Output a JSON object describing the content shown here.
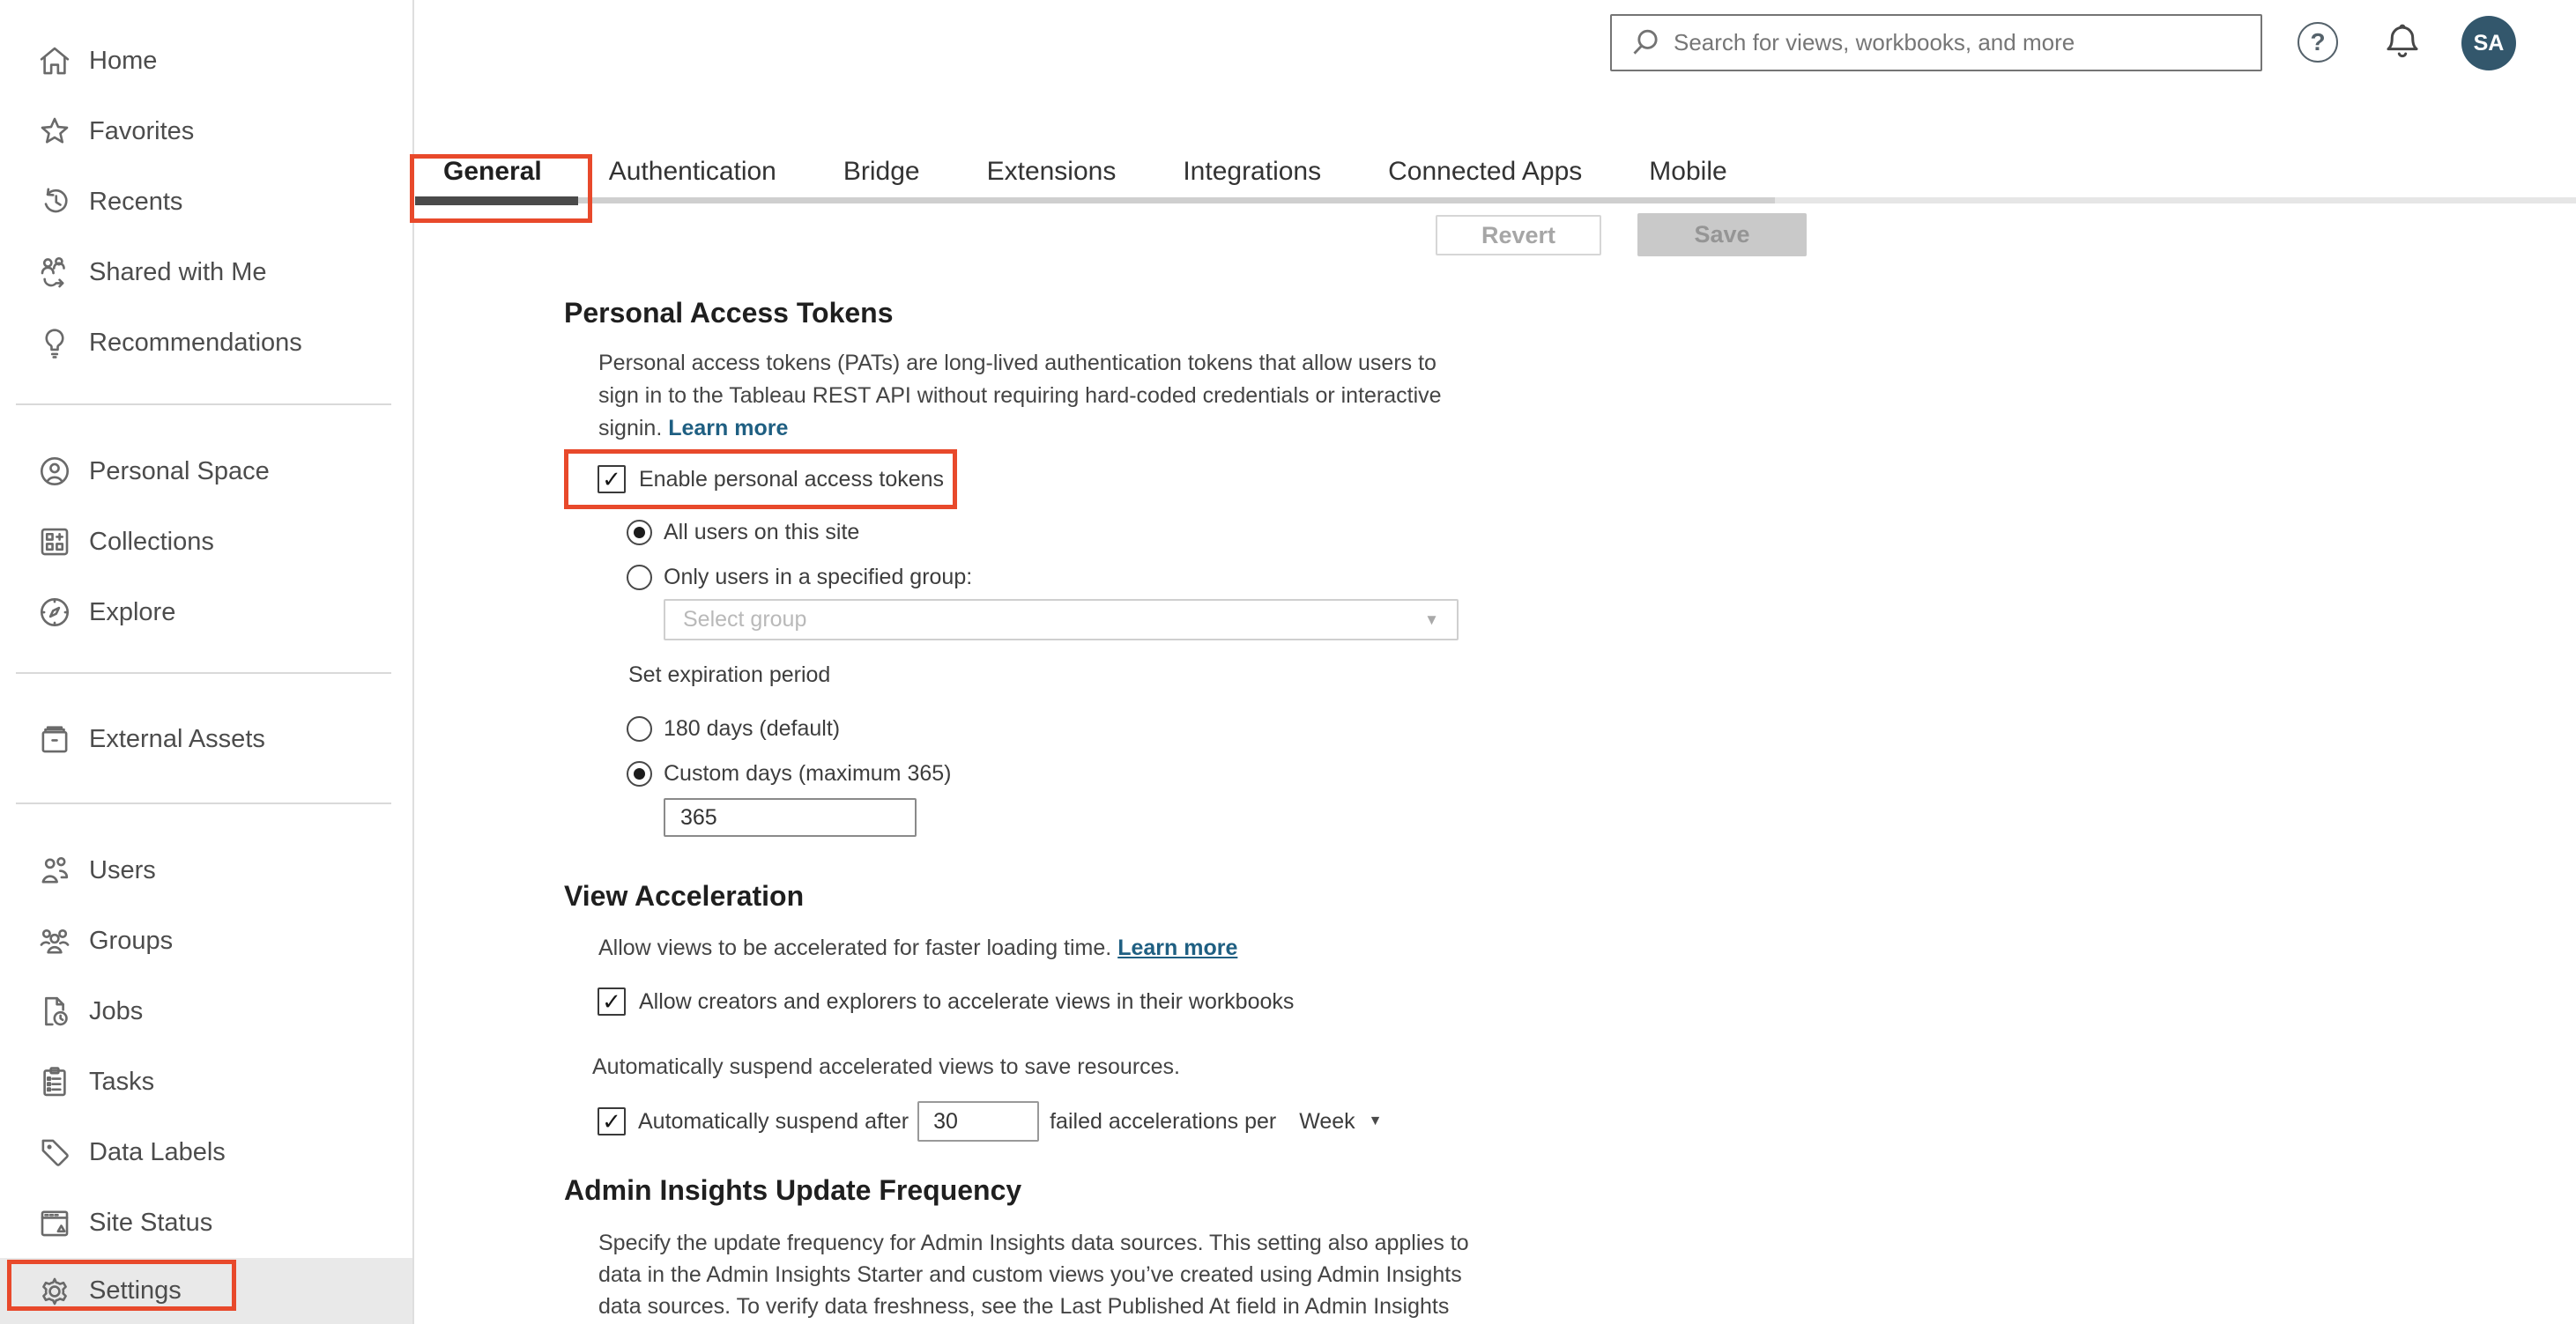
{
  "header": {
    "search": {
      "placeholder": "Search for views, workbooks, and more",
      "icon": "search-icon"
    },
    "help_icon_glyph": "?",
    "bell_icon": "bell-icon",
    "avatar": {
      "initials": "SA"
    }
  },
  "sidebar": {
    "items": [
      {
        "label": "Home",
        "icon": "home-icon"
      },
      {
        "label": "Favorites",
        "icon": "star-icon"
      },
      {
        "label": "Recents",
        "icon": "history-icon"
      },
      {
        "label": "Shared with Me",
        "icon": "shared-icon"
      },
      {
        "label": "Recommendations",
        "icon": "lightbulb-icon"
      },
      {
        "label": "Personal Space",
        "icon": "person-circle-icon"
      },
      {
        "label": "Collections",
        "icon": "collections-icon"
      },
      {
        "label": "Explore",
        "icon": "compass-icon"
      },
      {
        "label": "External Assets",
        "icon": "archive-icon"
      },
      {
        "label": "Users",
        "icon": "users-icon"
      },
      {
        "label": "Groups",
        "icon": "groups-icon"
      },
      {
        "label": "Jobs",
        "icon": "jobs-icon"
      },
      {
        "label": "Tasks",
        "icon": "tasks-icon"
      },
      {
        "label": "Data Labels",
        "icon": "tag-icon"
      },
      {
        "label": "Site Status",
        "icon": "site-status-icon"
      },
      {
        "label": "Settings",
        "icon": "gear-icon",
        "selected": true
      }
    ]
  },
  "tabs": {
    "items": [
      "General",
      "Authentication",
      "Bridge",
      "Extensions",
      "Integrations",
      "Connected Apps",
      "Mobile"
    ],
    "active": "General"
  },
  "toolbar": {
    "revert_label": "Revert",
    "save_label": "Save"
  },
  "sections": {
    "pat": {
      "title": "Personal Access Tokens",
      "description": "Personal access tokens (PATs) are long-lived authentication tokens that allow users to\nsign in to the Tableau REST API without requiring hard-coded credentials or interactive\nsignin.",
      "learn_more": "Learn more",
      "enable_checkbox_label": "Enable personal access tokens",
      "enable_checked": true,
      "radio_all_users": "All users on this site",
      "radio_all_users_selected": true,
      "radio_specified_group": "Only users in a specified group:",
      "group_select_placeholder": "Select group",
      "expiration_label": "Set expiration period",
      "radio_180": "180 days (default)",
      "radio_custom": "Custom days (maximum 365)",
      "radio_custom_selected": true,
      "custom_days_value": "365"
    },
    "view_acceleration": {
      "title": "View Acceleration",
      "description": "Allow views to be accelerated for faster loading time.",
      "learn_more": "Learn more",
      "allow_checkbox_label": "Allow creators and explorers to accelerate views in their workbooks",
      "allow_checked": true,
      "suspend_description": "Automatically suspend accelerated views to save resources.",
      "suspend_checkbox_label": "Automatically suspend after",
      "suspend_checked": true,
      "suspend_value": "30",
      "suspend_suffix": "failed accelerations per",
      "period_value": "Week"
    },
    "admin_insights": {
      "title": "Admin Insights Update Frequency",
      "description": "Specify the update frequency for Admin Insights data sources. This setting also applies to\ndata in the Admin Insights Starter and custom views you’ve created using Admin Insights\ndata sources. To verify data freshness, see the Last Published At field in Admin Insights"
    }
  },
  "colors": {
    "highlight_red": "#e8492b",
    "link_blue": "#1f5f82",
    "avatar_bg": "#33576c",
    "active_tab_underline": "#4a4a4a",
    "selected_nav_bg": "#e9e9e9"
  }
}
